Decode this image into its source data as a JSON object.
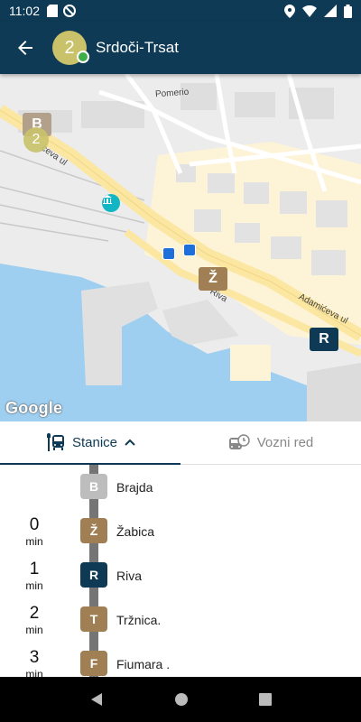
{
  "status_bar": {
    "time": "11:02",
    "left_icons": [
      "sd-card-icon",
      "blocked-icon"
    ],
    "right_icons": [
      "location-icon",
      "wifi-icon",
      "signal-icon",
      "battery-icon"
    ]
  },
  "app_bar": {
    "back_icon": "arrow-back-icon",
    "line_number": "2",
    "line_color": "#c9c26a",
    "online_color": "#3fae49",
    "title": "Srdoči-Trsat"
  },
  "map": {
    "labels": {
      "pomerio": "Pomerio",
      "ceva": "ceva ul",
      "adamiceva": "Adamićeva ul",
      "riva": "Riva"
    },
    "markers": [
      {
        "letter": "B",
        "color": "#b3a08a"
      },
      {
        "letter": "Ž",
        "color": "#a07f55"
      },
      {
        "letter": "R",
        "color": "#0e3a55"
      }
    ],
    "bus": {
      "number": "2"
    },
    "google": "Google"
  },
  "tabs": [
    {
      "label": "Stanice",
      "icon": "bus-stop-icon",
      "active": true
    },
    {
      "label": "Vozni red",
      "icon": "bus-schedule-icon",
      "active": false
    }
  ],
  "stops": [
    {
      "eta": "",
      "unit": "",
      "letter": "B",
      "name": "Brajda",
      "color": "#bdbdbd"
    },
    {
      "eta": "0",
      "unit": "min",
      "letter": "Ž",
      "name": "Žabica",
      "color": "#a07f55"
    },
    {
      "eta": "1",
      "unit": "min",
      "letter": "R",
      "name": "Riva",
      "color": "#0e3a55"
    },
    {
      "eta": "2",
      "unit": "min",
      "letter": "T",
      "name": "Tržnica.",
      "color": "#a07f55"
    },
    {
      "eta": "3",
      "unit": "min",
      "letter": "F",
      "name": "Fiumara .",
      "color": "#a07f55"
    }
  ],
  "colors": {
    "primary": "#0e3a55",
    "map_water": "#9ecff0",
    "map_road": "#fbe6a2"
  }
}
